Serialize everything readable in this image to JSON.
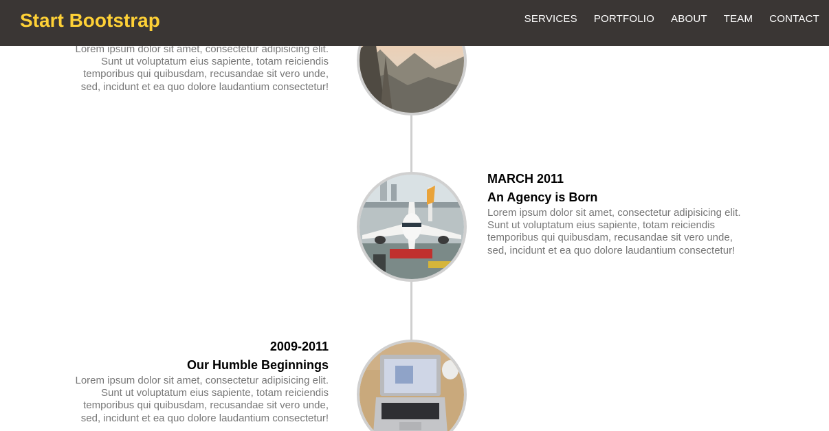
{
  "navbar": {
    "brand": "Start Bootstrap",
    "links": [
      "SERVICES",
      "PORTFOLIO",
      "ABOUT",
      "TEAM",
      "CONTACT"
    ]
  },
  "timeline": {
    "entries": [
      {
        "date": "",
        "title": "",
        "body": "Lorem ipsum dolor sit amet, consectetur adipisicing elit. Sunt ut voluptatum eius sapiente, totam reiciendis temporibus qui quibusdam, recusandae sit vero unde, sed, incidunt et ea quo dolore laudantium consectetur!",
        "image": "mountain-landscape-photo"
      },
      {
        "date": "MARCH 2011",
        "title": "An Agency is Born",
        "body": "Lorem ipsum dolor sit amet, consectetur adipisicing elit. Sunt ut voluptatum eius sapiente, totam reiciendis temporibus qui quibusdam, recusandae sit vero unde, sed, incidunt et ea quo dolore laudantium consectetur!",
        "image": "airplane-photo"
      },
      {
        "date": "2009-2011",
        "title": "Our Humble Beginnings",
        "body": "Lorem ipsum dolor sit amet, consectetur adipisicing elit. Sunt ut voluptatum eius sapiente, totam reiciendis temporibus qui quibusdam, recusandae sit vero unde, sed, incidunt et ea quo dolore laudantium consectetur!",
        "image": "laptop-photo"
      }
    ]
  },
  "colors": {
    "navbar_bg": "#3a3634",
    "brand": "#fed136",
    "body_text": "#777777",
    "timeline_line": "#cfcfcf"
  }
}
